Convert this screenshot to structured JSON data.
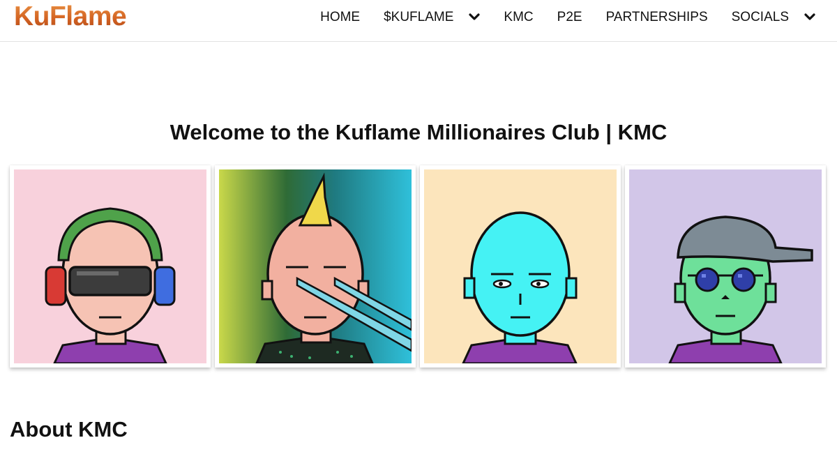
{
  "brand": {
    "logo_text": "KuFlame"
  },
  "nav": {
    "items": [
      {
        "label": "HOME",
        "has_dropdown": false
      },
      {
        "label": "$KUFLAME",
        "has_dropdown": true
      },
      {
        "label": "KMC",
        "has_dropdown": false
      },
      {
        "label": "P2E",
        "has_dropdown": false
      },
      {
        "label": "PARTNERSHIPS",
        "has_dropdown": false
      },
      {
        "label": "SOCIALS",
        "has_dropdown": true
      }
    ]
  },
  "hero": {
    "title": "Welcome to the Kuflame Millionaires Club | KMC"
  },
  "gallery": {
    "avatars": [
      {
        "background": "#f8d1dc",
        "skin": "#f6c3b4",
        "accessory": "vr-headset-headphones"
      },
      {
        "background": "gradient-olive-to-cyan",
        "skin": "#f2b0a0",
        "accessory": "mohawk-laser-eyes"
      },
      {
        "background": "#fce5bc",
        "skin": "#45f2f4",
        "accessory": "none"
      },
      {
        "background": "#d2c6e8",
        "skin": "#6ee09a",
        "accessory": "cap-sunglasses"
      }
    ]
  },
  "about": {
    "heading": "About KMC"
  },
  "colors": {
    "logo_orange": "#e06a25",
    "shirt_purple": "#8e3fae"
  }
}
